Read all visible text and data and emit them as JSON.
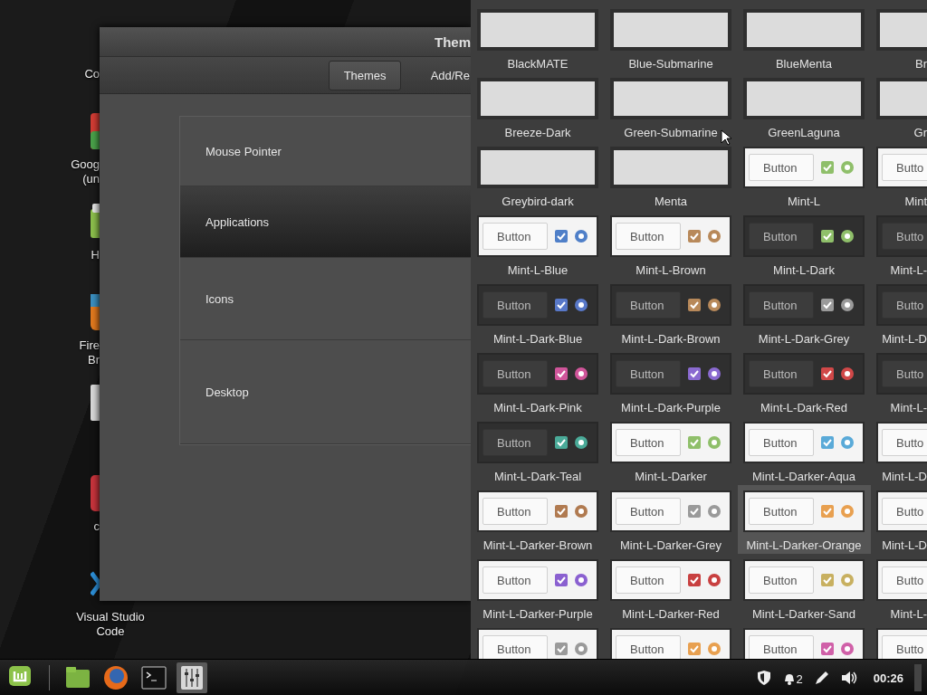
{
  "desktop_icons": [
    {
      "label": "Co",
      "kind": "none"
    },
    {
      "label": "Goog\n(un",
      "kind": "chrome"
    },
    {
      "label": "H",
      "kind": "folder"
    },
    {
      "label": "Fire\nBr",
      "kind": "firefox"
    },
    {
      "kind": "file"
    },
    {
      "label": "c",
      "kind": "red"
    },
    {
      "label": "Visual Studio\nCode",
      "kind": "vscode"
    }
  ],
  "window": {
    "title": "Them",
    "tabs": [
      {
        "label": "Themes",
        "selected": true
      },
      {
        "label": "Add/Re",
        "selected": false
      }
    ],
    "categories": [
      {
        "label": "Mouse Pointer",
        "selected": false
      },
      {
        "label": "Applications",
        "selected": true
      },
      {
        "label": "Icons",
        "selected": false
      },
      {
        "label": "Desktop",
        "selected": false
      }
    ]
  },
  "themes": [
    {
      "kind": "plain",
      "label": "BlackMATE",
      "selected": false
    },
    {
      "kind": "plain",
      "label": "Blue-Submarine",
      "selected": false
    },
    {
      "kind": "plain",
      "label": "BlueMenta",
      "selected": false
    },
    {
      "kind": "plain",
      "label": "Br",
      "selected": false
    },
    {
      "kind": "plain",
      "label": "Breeze-Dark",
      "selected": false
    },
    {
      "kind": "plain",
      "label": "Green-Submarine",
      "selected": false
    },
    {
      "kind": "plain",
      "label": "GreenLaguna",
      "selected": false
    },
    {
      "kind": "plain",
      "label": "Gr",
      "selected": false
    },
    {
      "kind": "plain",
      "label": "Greybird-dark",
      "selected": false
    },
    {
      "kind": "plain",
      "label": "Menta",
      "selected": false
    },
    {
      "kind": "light",
      "label": "Mint-L",
      "button": "Button",
      "color": "#8fbf6a",
      "selected": false
    },
    {
      "kind": "light",
      "label": "Mint",
      "button": "Butto",
      "selected": false
    },
    {
      "kind": "light",
      "label": "Mint-L-Blue",
      "button": "Button",
      "color": "#4f7fc8",
      "selected": false
    },
    {
      "kind": "light",
      "label": "Mint-L-Brown",
      "button": "Button",
      "color": "#b8895a",
      "selected": false
    },
    {
      "kind": "dark",
      "label": "Mint-L-Dark",
      "button": "Button",
      "color": "#8fbf6a",
      "selected": false
    },
    {
      "kind": "dark",
      "label": "Mint-L-",
      "button": "Butto",
      "selected": false
    },
    {
      "kind": "dark",
      "label": "Mint-L-Dark-Blue",
      "button": "Button",
      "color": "#5878c8",
      "selected": false
    },
    {
      "kind": "dark",
      "label": "Mint-L-Dark-Brown",
      "button": "Button",
      "color": "#b8895a",
      "selected": false
    },
    {
      "kind": "dark",
      "label": "Mint-L-Dark-Grey",
      "button": "Button",
      "color": "#9a9a9a",
      "selected": false
    },
    {
      "kind": "dark",
      "label": "Mint-L-D",
      "button": "Butto",
      "selected": false
    },
    {
      "kind": "dark",
      "label": "Mint-L-Dark-Pink",
      "button": "Button",
      "color": "#d0559a",
      "selected": false
    },
    {
      "kind": "dark",
      "label": "Mint-L-Dark-Purple",
      "button": "Button",
      "color": "#8a6ad0",
      "selected": false
    },
    {
      "kind": "dark",
      "label": "Mint-L-Dark-Red",
      "button": "Button",
      "color": "#d04848",
      "selected": false
    },
    {
      "kind": "dark",
      "label": "Mint-L-",
      "button": "Butto",
      "selected": false
    },
    {
      "kind": "dark",
      "label": "Mint-L-Dark-Teal",
      "button": "Button",
      "color": "#4aaa98",
      "selected": false
    },
    {
      "kind": "light",
      "label": "Mint-L-Darker",
      "button": "Button",
      "color": "#8fbf6a",
      "selected": false
    },
    {
      "kind": "light",
      "label": "Mint-L-Darker-Aqua",
      "button": "Button",
      "color": "#5aaad8",
      "selected": false
    },
    {
      "kind": "light",
      "label": "Mint-L-D",
      "button": "Butto",
      "selected": false
    },
    {
      "kind": "light",
      "label": "Mint-L-Darker-Brown",
      "button": "Button",
      "color": "#b07a50",
      "selected": false
    },
    {
      "kind": "light",
      "label": "Mint-L-Darker-Grey",
      "button": "Button",
      "color": "#9a9a9a",
      "selected": false
    },
    {
      "kind": "light",
      "label": "Mint-L-Darker-Orange",
      "button": "Button",
      "color": "#e8a050",
      "selected": true
    },
    {
      "kind": "light",
      "label": "Mint-L-D",
      "button": "Butto",
      "selected": false
    },
    {
      "kind": "light",
      "label": "Mint-L-Darker-Purple",
      "button": "Button",
      "color": "#8a60d0",
      "selected": false
    },
    {
      "kind": "light",
      "label": "Mint-L-Darker-Red",
      "button": "Button",
      "color": "#c84040",
      "selected": false
    },
    {
      "kind": "light",
      "label": "Mint-L-Darker-Sand",
      "button": "Button",
      "color": "#c8b060",
      "selected": false
    },
    {
      "kind": "light",
      "label": "Mint-L-",
      "button": "Butto",
      "selected": false
    },
    {
      "kind": "light",
      "button": "Button",
      "color": "#9a9a9a",
      "selected": false
    },
    {
      "kind": "light",
      "button": "Button",
      "color": "#e8a050",
      "selected": false
    },
    {
      "kind": "light",
      "button": "Button",
      "color": "#d060a8",
      "selected": false
    },
    {
      "kind": "light",
      "button": "Butto",
      "selected": false
    }
  ],
  "taskbar": {
    "launchers": [
      {
        "kind": "menu",
        "selected": false
      },
      {
        "kind": "folder",
        "selected": false
      },
      {
        "kind": "firefox",
        "selected": false
      },
      {
        "kind": "terminal",
        "selected": false
      },
      {
        "kind": "mixer",
        "selected": true
      }
    ],
    "tray": [
      {
        "kind": "shield"
      },
      {
        "kind": "notifications",
        "count": "2"
      },
      {
        "kind": "pen"
      },
      {
        "kind": "volume"
      }
    ],
    "clock": "00:26"
  }
}
